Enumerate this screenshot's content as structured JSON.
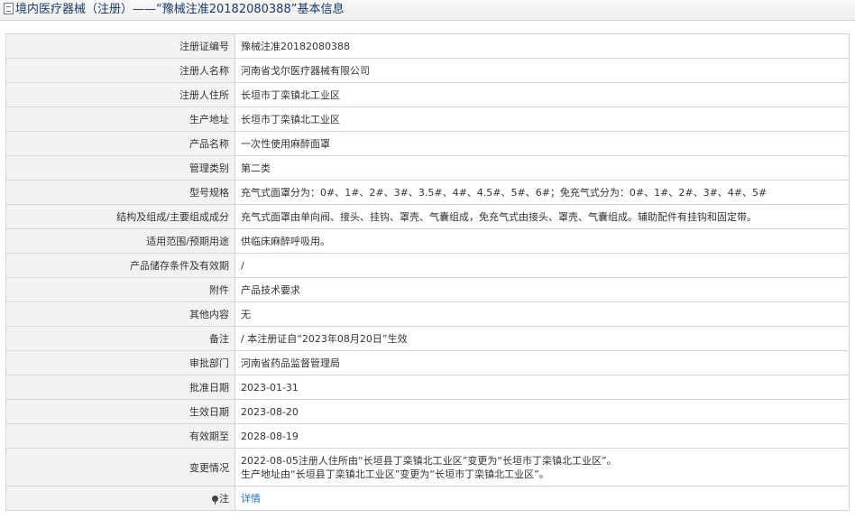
{
  "header": {
    "title": "境内医疗器械（注册）——“豫械注准20182080388”基本信息",
    "icon": "document-icon"
  },
  "rows": [
    {
      "label": "注册证编号",
      "value": "豫械注准20182080388"
    },
    {
      "label": "注册人名称",
      "value": "河南省戈尔医疗器械有限公司"
    },
    {
      "label": "注册人住所",
      "value": "长垣市丁栾镇北工业区"
    },
    {
      "label": "生产地址",
      "value": "长垣市丁栾镇北工业区"
    },
    {
      "label": "产品名称",
      "value": "一次性使用麻醉面罩"
    },
    {
      "label": "管理类别",
      "value": "第二类"
    },
    {
      "label": "型号规格",
      "value": "充气式面罩分为：0#、1#、2#、3#、3.5#、4#、4.5#、5#、6#；免充气式分为：0#、1#、2#、3#、4#、5#"
    },
    {
      "label": "结构及组成/主要组成成分",
      "value": "充气式面罩由单向阀、接头、挂钩、罩壳、气囊组成，免充气式由接头、罩壳、气囊组成。辅助配件有挂钩和固定带。"
    },
    {
      "label": "适用范围/预期用途",
      "value": "供临床麻醉呼吸用。"
    },
    {
      "label": "产品储存条件及有效期",
      "value": "/"
    },
    {
      "label": "附件",
      "value": "产品技术要求"
    },
    {
      "label": "其他内容",
      "value": "无"
    },
    {
      "label": "备注",
      "value": "/ 本注册证自“2023年08月20日”生效"
    },
    {
      "label": "审批部门",
      "value": "河南省药品监督管理局"
    },
    {
      "label": "批准日期",
      "value": "2023-01-31"
    },
    {
      "label": "生效日期",
      "value": "2023-08-20"
    },
    {
      "label": "有效期至",
      "value": "2028-08-19"
    }
  ],
  "change": {
    "label": "变更情况",
    "line1": "2022-08-05注册人住所由“长垣县丁栾镇北工业区”变更为“长垣市丁栾镇北工业区”。",
    "line2": "生产地址由“长垣县丁栾镇北工业区”变更为“长垣市丁栾镇北工业区”。"
  },
  "note": {
    "icon": "pin-icon",
    "label": "注",
    "link_text": "详情"
  }
}
